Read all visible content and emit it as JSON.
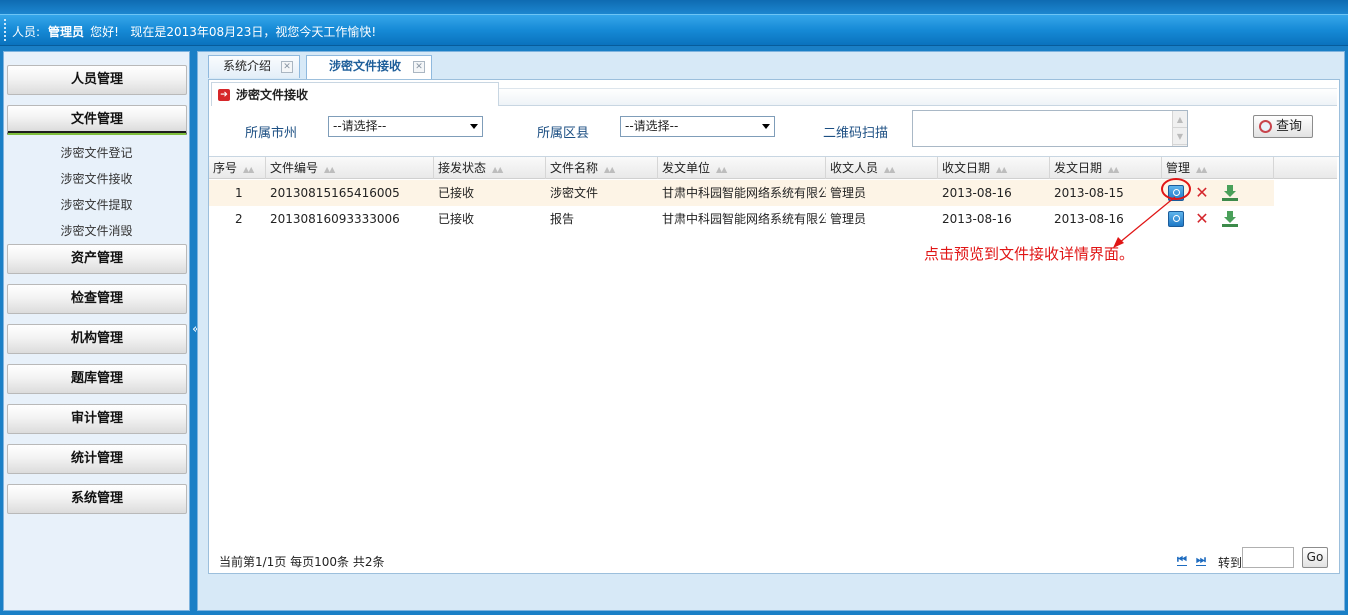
{
  "header": {
    "person_label": "人员:",
    "user_name": "管理员",
    "greeting": "您好!",
    "date_message": "现在是2013年08月23日，视您今天工作愉快!"
  },
  "sidebar": {
    "menus": [
      {
        "label": "人员管理"
      },
      {
        "label": "文件管理"
      },
      {
        "label": "资产管理"
      },
      {
        "label": "检查管理"
      },
      {
        "label": "机构管理"
      },
      {
        "label": "题库管理"
      },
      {
        "label": "审计管理"
      },
      {
        "label": "统计管理"
      },
      {
        "label": "系统管理"
      }
    ],
    "sub_items": [
      {
        "label": "涉密文件登记"
      },
      {
        "label": "涉密文件接收"
      },
      {
        "label": "涉密文件提取"
      },
      {
        "label": "涉密文件消毁"
      }
    ],
    "collapse_glyph": "«"
  },
  "tabs": [
    {
      "label": "系统介绍"
    },
    {
      "label": "涉密文件接收"
    }
  ],
  "section": {
    "title": "涉密文件接收"
  },
  "filters": {
    "city_label": "所属市州",
    "city_value": "--请选择--",
    "district_label": "所属区县",
    "district_value": "--请选择--",
    "qr_label": "二维码扫描",
    "query_label": "查询"
  },
  "table": {
    "columns": [
      "序号",
      "文件编号",
      "接发状态",
      "文件名称",
      "发文单位",
      "收文人员",
      "收文日期",
      "发文日期",
      "管理"
    ],
    "rows": [
      {
        "index": "1",
        "file_no": "20130815165416005",
        "status": "已接收",
        "name": "涉密文件",
        "sender": "甘肃中科园智能网络系统有限公司",
        "receiver": "管理员",
        "received": "2013-08-16",
        "sent": "2013-08-15"
      },
      {
        "index": "2",
        "file_no": "20130816093333006",
        "status": "已接收",
        "name": "报告",
        "sender": "甘肃中科园智能网络系统有限公司",
        "receiver": "管理员",
        "received": "2013-08-16",
        "sent": "2013-08-16"
      }
    ]
  },
  "annotation": "点击预览到文件接收详情界面。",
  "pager": {
    "info": "当前第1/1页  每页100条  共2条",
    "first_glyph": "⏮",
    "prev_glyph": "⏭",
    "goto_label": "转到",
    "go_label": "Go"
  },
  "colors": {
    "accent": "#168ad6",
    "annotation": "#e01515",
    "row_highlight": "#fdf4e6"
  }
}
